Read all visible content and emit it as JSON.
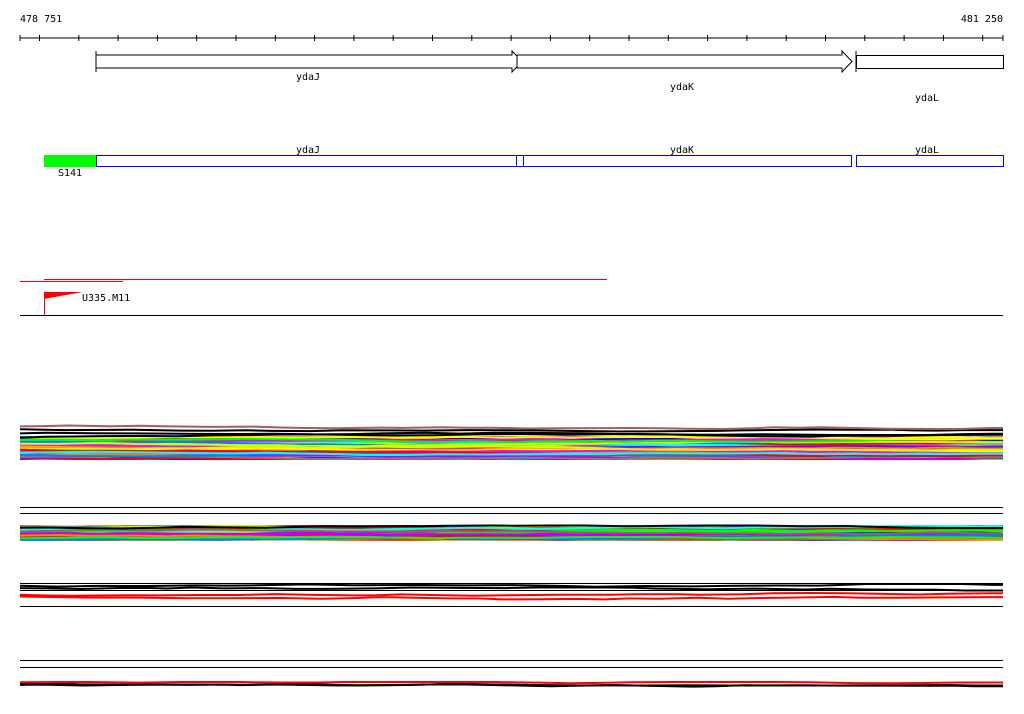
{
  "ruler": {
    "start": "478 751",
    "end": "481 250"
  },
  "genes_track": [
    {
      "name": "ydaJ"
    },
    {
      "name": "ydaK"
    },
    {
      "name": "ydaL"
    }
  ],
  "features_track": {
    "marker_label": "S141",
    "genes": [
      {
        "name": "ydaJ"
      },
      {
        "name": "ydaK"
      },
      {
        "name": "ydaL"
      }
    ]
  },
  "clone": {
    "label": "U335.M11"
  },
  "colors": {
    "marker": "#00ff00",
    "feature_outline": "#0000ff",
    "clone": "#ff0000",
    "palette": [
      "#ff0000",
      "#00ff00",
      "#0000ff",
      "#ff00ff",
      "#00ffff",
      "#ffff00",
      "#ff8000",
      "#8000ff",
      "#808080",
      "#ccff00",
      "#c000ff",
      "#0080ff",
      "#a06060"
    ]
  }
}
